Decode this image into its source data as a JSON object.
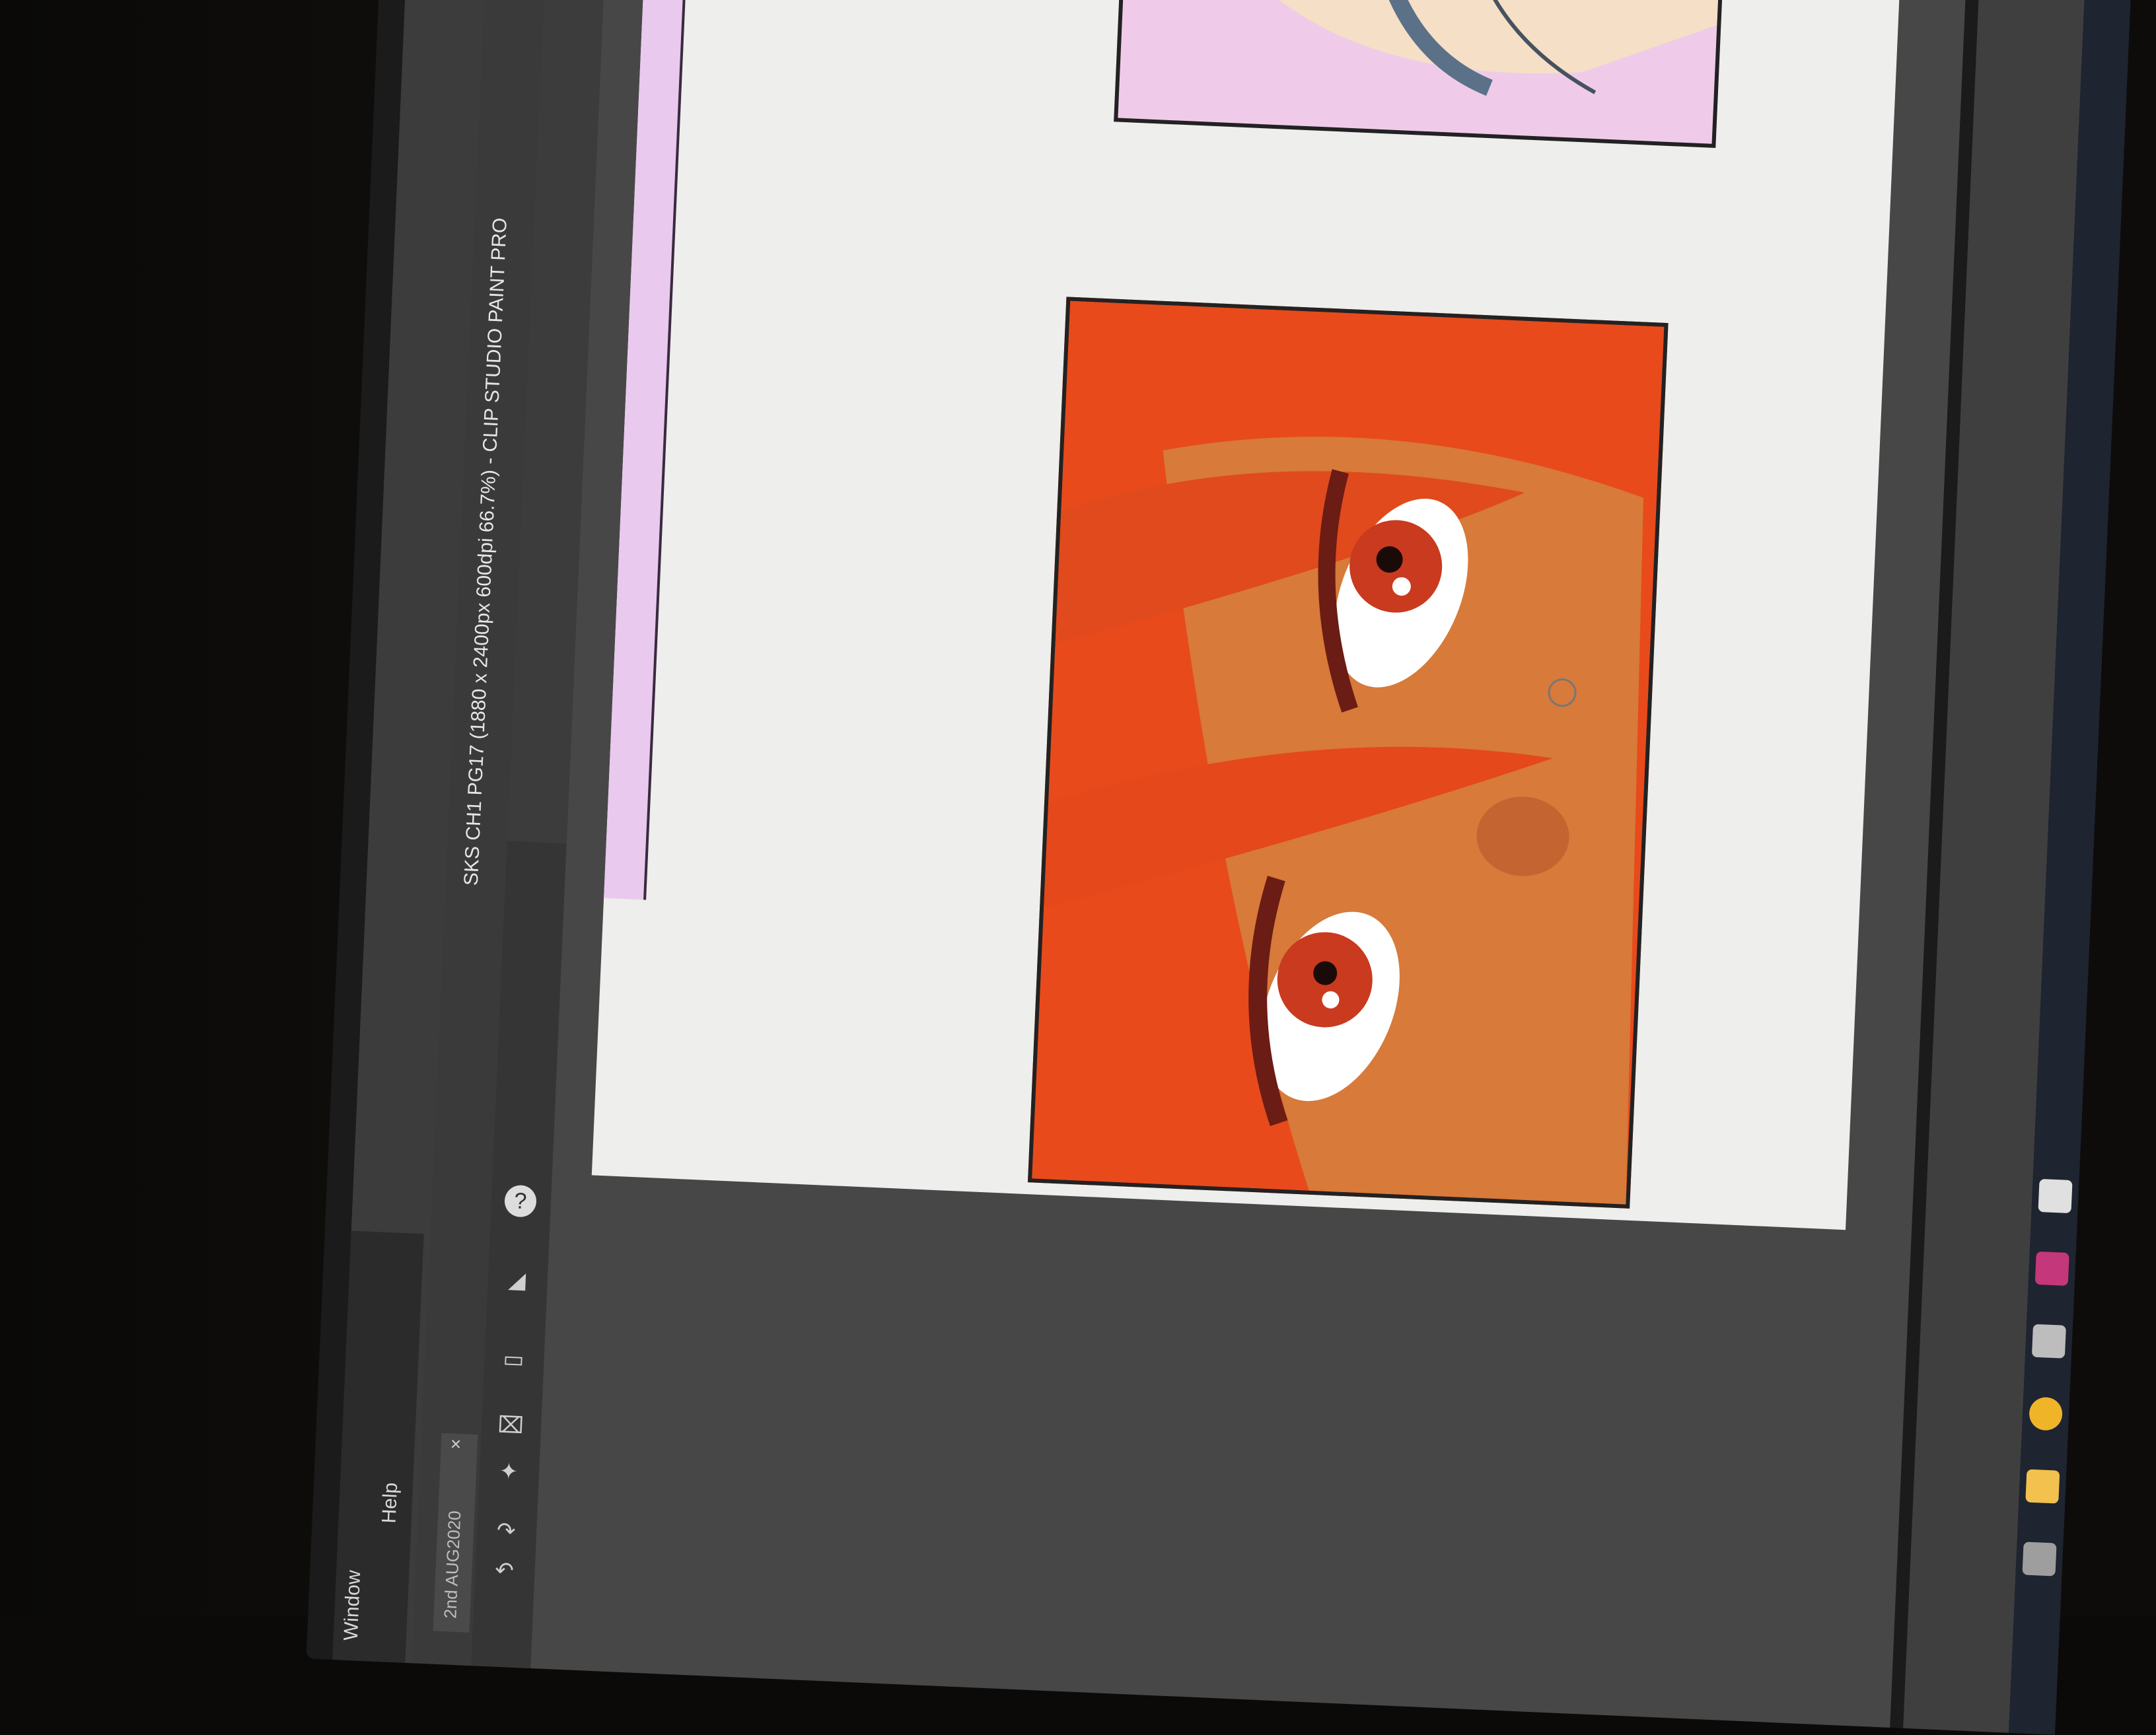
{
  "menu": {
    "items": [
      "Window",
      "Help"
    ]
  },
  "window": {
    "title": "SKS CH1 PG17 (1880 x 2400px 600dpi 66.7%) - CLIP STUDIO PAINT PRO"
  },
  "document_tab": {
    "label": "2nd AUG2020",
    "close": "×"
  },
  "toolbar": {
    "icons": [
      "undo-icon",
      "redo-icon",
      "new-icon",
      "transform-icon",
      "selection-icon",
      "fill-icon",
      "help-icon"
    ]
  },
  "taskbar": {
    "icons": [
      "pinwheel-icon",
      "game-icon",
      "swirl-icon",
      "chrome-icon",
      "folder-icon",
      "trash-icon"
    ]
  },
  "colors": {
    "hair": "#e84a1c",
    "skin": "#d77a3a",
    "iris": "#c93a1f",
    "panel_top": "#efcbe9",
    "page": "#eeeeec"
  }
}
